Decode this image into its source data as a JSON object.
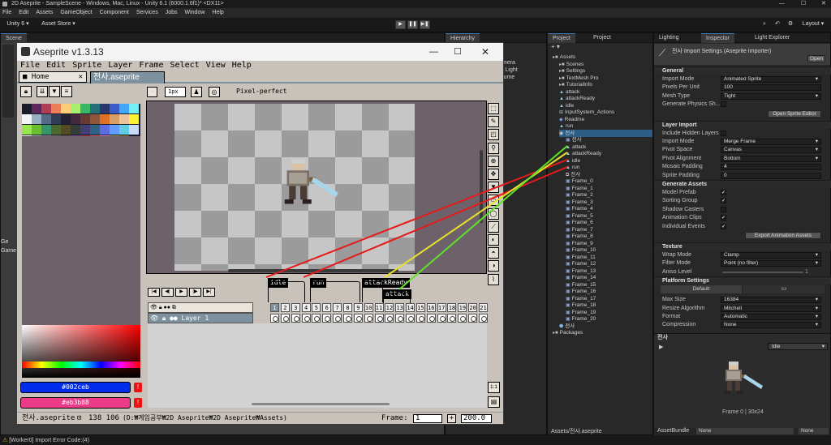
{
  "unity": {
    "window_title": "2D Aseprite - SampleScene - Windows, Mac, Linux - Unity 6.1 (6000.1.6f1)* <DX11>",
    "menu": [
      "File",
      "Edit",
      "Assets",
      "GameObject",
      "Component",
      "Services",
      "Jobs",
      "Window",
      "Help"
    ],
    "account": "Unity 6",
    "asset_store": "Asset Store",
    "layout": "Layout",
    "scene_tab": "Scene",
    "hierarchy_tab": "Hierarchy",
    "hierarchy_items": [
      "mera",
      "l Light",
      "lume"
    ],
    "project_tab_1": "Project",
    "project_tab_2": "Project",
    "project_tree": [
      {
        "label": "Assets",
        "indent": 0,
        "icon": "folder-icon"
      },
      {
        "label": "Scenes",
        "indent": 1,
        "icon": "folder-icon"
      },
      {
        "label": "Settings",
        "indent": 1,
        "icon": "folder-icon"
      },
      {
        "label": "TextMesh Pro",
        "indent": 1,
        "icon": "folder-icon"
      },
      {
        "label": "TutorialInfo",
        "indent": 1,
        "icon": "folder-icon"
      },
      {
        "label": "attack",
        "indent": 1,
        "icon": "anim-icon"
      },
      {
        "label": "attackReady",
        "indent": 1,
        "icon": "anim-icon"
      },
      {
        "label": "idle",
        "indent": 1,
        "icon": "anim-icon"
      },
      {
        "label": "InputSystem_Actions",
        "indent": 1,
        "icon": "input-icon"
      },
      {
        "label": "Readme",
        "indent": 1,
        "icon": "readme-icon"
      },
      {
        "label": "run",
        "indent": 1,
        "icon": "anim-icon"
      },
      {
        "label": "전사",
        "indent": 1,
        "icon": "aseprite-icon"
      },
      {
        "label": "전사",
        "indent": 2,
        "icon": "sprite-icon"
      },
      {
        "label": "attack",
        "indent": 2,
        "icon": "anim-icon"
      },
      {
        "label": "attackReady",
        "indent": 2,
        "icon": "anim-icon"
      },
      {
        "label": "idle",
        "indent": 2,
        "icon": "anim-icon"
      },
      {
        "label": "run",
        "indent": 2,
        "icon": "anim-icon"
      },
      {
        "label": "전사",
        "indent": 2,
        "icon": "controller-icon"
      },
      {
        "label": "Frame_0",
        "indent": 2,
        "icon": "sprite-icon"
      },
      {
        "label": "Frame_1",
        "indent": 2,
        "icon": "sprite-icon"
      },
      {
        "label": "Frame_2",
        "indent": 2,
        "icon": "sprite-icon"
      },
      {
        "label": "Frame_3",
        "indent": 2,
        "icon": "sprite-icon"
      },
      {
        "label": "Frame_4",
        "indent": 2,
        "icon": "sprite-icon"
      },
      {
        "label": "Frame_5",
        "indent": 2,
        "icon": "sprite-icon"
      },
      {
        "label": "Frame_6",
        "indent": 2,
        "icon": "sprite-icon"
      },
      {
        "label": "Frame_7",
        "indent": 2,
        "icon": "sprite-icon"
      },
      {
        "label": "Frame_8",
        "indent": 2,
        "icon": "sprite-icon"
      },
      {
        "label": "Frame_9",
        "indent": 2,
        "icon": "sprite-icon"
      },
      {
        "label": "Frame_10",
        "indent": 2,
        "icon": "sprite-icon"
      },
      {
        "label": "Frame_11",
        "indent": 2,
        "icon": "sprite-icon"
      },
      {
        "label": "Frame_12",
        "indent": 2,
        "icon": "sprite-icon"
      },
      {
        "label": "Frame_13",
        "indent": 2,
        "icon": "sprite-icon"
      },
      {
        "label": "Frame_14",
        "indent": 2,
        "icon": "sprite-icon"
      },
      {
        "label": "Frame_15",
        "indent": 2,
        "icon": "sprite-icon"
      },
      {
        "label": "Frame_16",
        "indent": 2,
        "icon": "sprite-icon"
      },
      {
        "label": "Frame_17",
        "indent": 2,
        "icon": "sprite-icon"
      },
      {
        "label": "Frame_18",
        "indent": 2,
        "icon": "sprite-icon"
      },
      {
        "label": "Frame_19",
        "indent": 2,
        "icon": "sprite-icon"
      },
      {
        "label": "Frame_20",
        "indent": 2,
        "icon": "sprite-icon"
      },
      {
        "label": "전사",
        "indent": 1,
        "icon": "prefab-icon"
      },
      {
        "label": "Packages",
        "indent": 0,
        "icon": "folder-icon"
      }
    ],
    "project_footer": "Assets/전사.aseprite",
    "tabs_right": [
      "Lighting",
      "Inspector",
      "Light Explorer"
    ],
    "inspector": {
      "title": "전사 Import Settings (Aseprite Importer)",
      "open_button": "Open",
      "general_header": "General",
      "general": [
        {
          "label": "Import Mode",
          "value": "Animated Sprite",
          "kind": "dropdown"
        },
        {
          "label": "Pixels Per Unit",
          "value": "100",
          "kind": "field"
        },
        {
          "label": "Mesh Type",
          "value": "Tight",
          "kind": "dropdown"
        },
        {
          "label": "Generate Physics Sh...",
          "value": "",
          "kind": "check-off"
        }
      ],
      "open_sprite_editor": "Open Sprite Editor",
      "layer_header": "Layer Import",
      "layer": [
        {
          "label": "Include Hidden Layers",
          "value": "",
          "kind": "check-off"
        },
        {
          "label": "Import Mode",
          "value": "Merge Frame",
          "kind": "dropdown"
        },
        {
          "label": "Pivot Space",
          "value": "Canvas",
          "kind": "dropdown"
        },
        {
          "label": "Pivot Alignment",
          "value": "Bottom",
          "kind": "dropdown"
        },
        {
          "label": "Mosaic Padding",
          "value": "4",
          "kind": "field"
        },
        {
          "label": "Sprite Padding",
          "value": "0",
          "kind": "field"
        }
      ],
      "gen_header": "Generate Assets",
      "gen": [
        {
          "label": "Model Prefab",
          "value": "✓",
          "kind": "check-on"
        },
        {
          "label": "Sorting Group",
          "value": "✓",
          "kind": "check-on"
        },
        {
          "label": "Shadow Casters",
          "value": "",
          "kind": "check-off"
        },
        {
          "label": "Animation Clips",
          "value": "✓",
          "kind": "check-on"
        },
        {
          "label": "Individual Events",
          "value": "✓",
          "kind": "check-on"
        }
      ],
      "export_button": "Export Animation Assets",
      "texture_header": "Texture",
      "texture": [
        {
          "label": "Wrap Mode",
          "value": "Clamp",
          "kind": "dropdown"
        },
        {
          "label": "Filter Mode",
          "value": "Point (no filter)",
          "kind": "dropdown"
        },
        {
          "label": "Aniso Level",
          "value": "1",
          "kind": "slider"
        }
      ],
      "platform_header": "Platform Settings",
      "platform_tab_default": "Default",
      "platform": [
        {
          "label": "Max Size",
          "value": "16384",
          "kind": "dropdown"
        },
        {
          "label": "Resize Algorithm",
          "value": "Mitchell",
          "kind": "dropdown"
        },
        {
          "label": "Format",
          "value": "Automatic",
          "kind": "dropdown"
        },
        {
          "label": "Compression",
          "value": "None",
          "kind": "dropdown"
        }
      ],
      "preview_name": "전사",
      "preview_clip": "Idle",
      "preview_caption": "Frame 0 | 30x24",
      "assetbundle_label": "AssetBundle",
      "assetbundle_value": "None",
      "assetbundle_variant": "None"
    },
    "status_text": "[Worker0] Import Error Code:(4)",
    "left_labels": [
      "Ge",
      "Game"
    ]
  },
  "aseprite": {
    "title": "Aseprite v1.3.13",
    "menu": [
      "File",
      "Edit",
      "Sprite",
      "Layer",
      "Frame",
      "Select",
      "View",
      "Help"
    ],
    "home_tab": "Home",
    "file_tab": "전사.aseprite",
    "brush_size": "1px",
    "pixel_perfect": "Pixel-perfect",
    "fg_color": "#002ceb",
    "bg_color": "#eb3b88",
    "layer_name": "Layer 1",
    "frames": [
      "1",
      "2",
      "3",
      "4",
      "5",
      "6",
      "7",
      "8",
      "9",
      "10",
      "11",
      "12",
      "13",
      "14",
      "15",
      "16",
      "17",
      "18",
      "19",
      "20",
      "21"
    ],
    "tags": [
      "idle",
      "run",
      "attackReady",
      "attack"
    ],
    "status_file": "전사.aseprite",
    "status_size": "138 106",
    "status_path": "(D:₩게임공부₩2D Aseprite₩2D Aseprite₩Assets)",
    "frame_label": "Frame:",
    "frame_value": "1",
    "zoom_value": "200.0",
    "zoom_btn": "1:1",
    "palette": [
      "#1a1c2c",
      "#5d275d",
      "#b13e53",
      "#ef7d57",
      "#ffcd75",
      "#a7f070",
      "#38b764",
      "#257179",
      "#29366f",
      "#3b5dc9",
      "#41a6f6",
      "#73eff7",
      "#f4f4f4",
      "#94b0c2",
      "#566c86",
      "#333c57",
      "#222034",
      "#45283c",
      "#663931",
      "#8f563b",
      "#df7126",
      "#d9a066",
      "#eec39a",
      "#fbf236",
      "#99e550",
      "#6abe30",
      "#37946e",
      "#4b692f",
      "#524b24",
      "#323c39",
      "#3f3f74",
      "#306082",
      "#5b6ee1",
      "#639bff",
      "#5fcde4",
      "#cbdbfc",
      "#ffffff",
      "#9badb7",
      "#847e87",
      "#696a6a",
      "#595652",
      "#76428a",
      "#ac3232",
      "#d95763",
      "#d77bba",
      "#8f974a",
      "#8a6f30"
    ]
  }
}
